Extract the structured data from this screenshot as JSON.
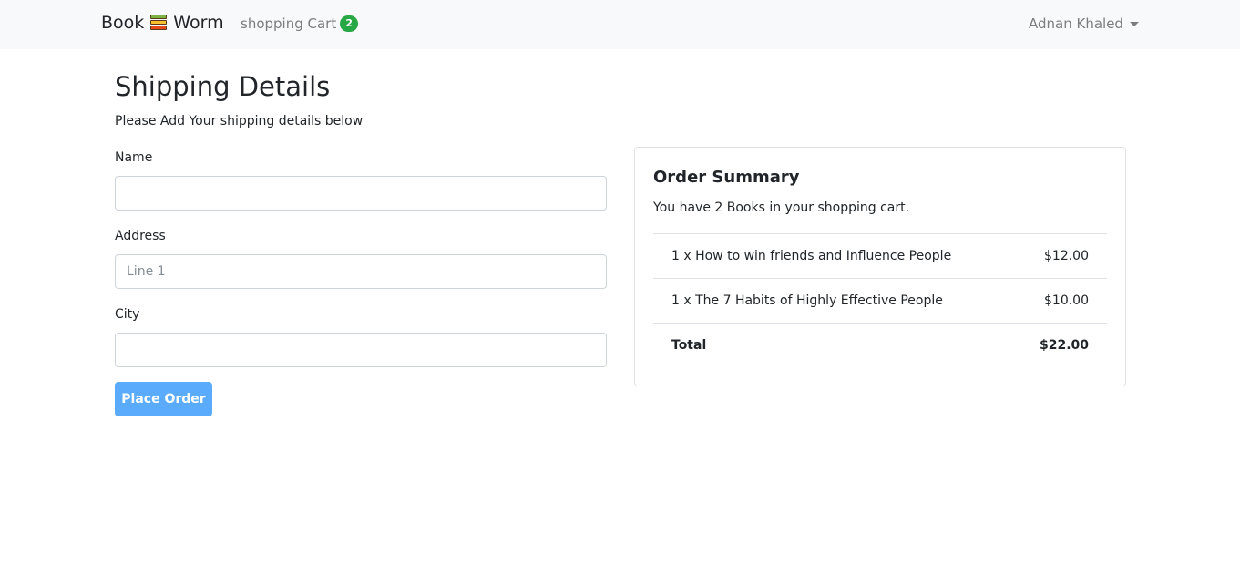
{
  "navbar": {
    "brand_left": "Book",
    "brand_right": "Worm",
    "brand_icon": "books-icon",
    "cart_label": "shopping Cart",
    "cart_count": "2",
    "user_name": "Adnan Khaled"
  },
  "page": {
    "title": "Shipping Details",
    "subtitle": "Please Add Your shipping details below"
  },
  "form": {
    "name_label": "Name",
    "name_value": "",
    "address_label": "Address",
    "address_placeholder": "Line 1",
    "city_label": "City",
    "city_value": "",
    "submit_label": "Place Order"
  },
  "summary": {
    "title": "Order Summary",
    "text": "You have 2 Books in your shopping cart.",
    "items": [
      {
        "label": "1 x How to win friends and Influence People",
        "price": "$12.00"
      },
      {
        "label": "1 x The 7 Habits of Highly Effective People",
        "price": "$10.00"
      }
    ],
    "total_label": "Total",
    "total_value": "$22.00"
  },
  "colors": {
    "navbar_bg": "#f8f9fa",
    "badge": "#28a745",
    "button": "#5aabfc"
  }
}
